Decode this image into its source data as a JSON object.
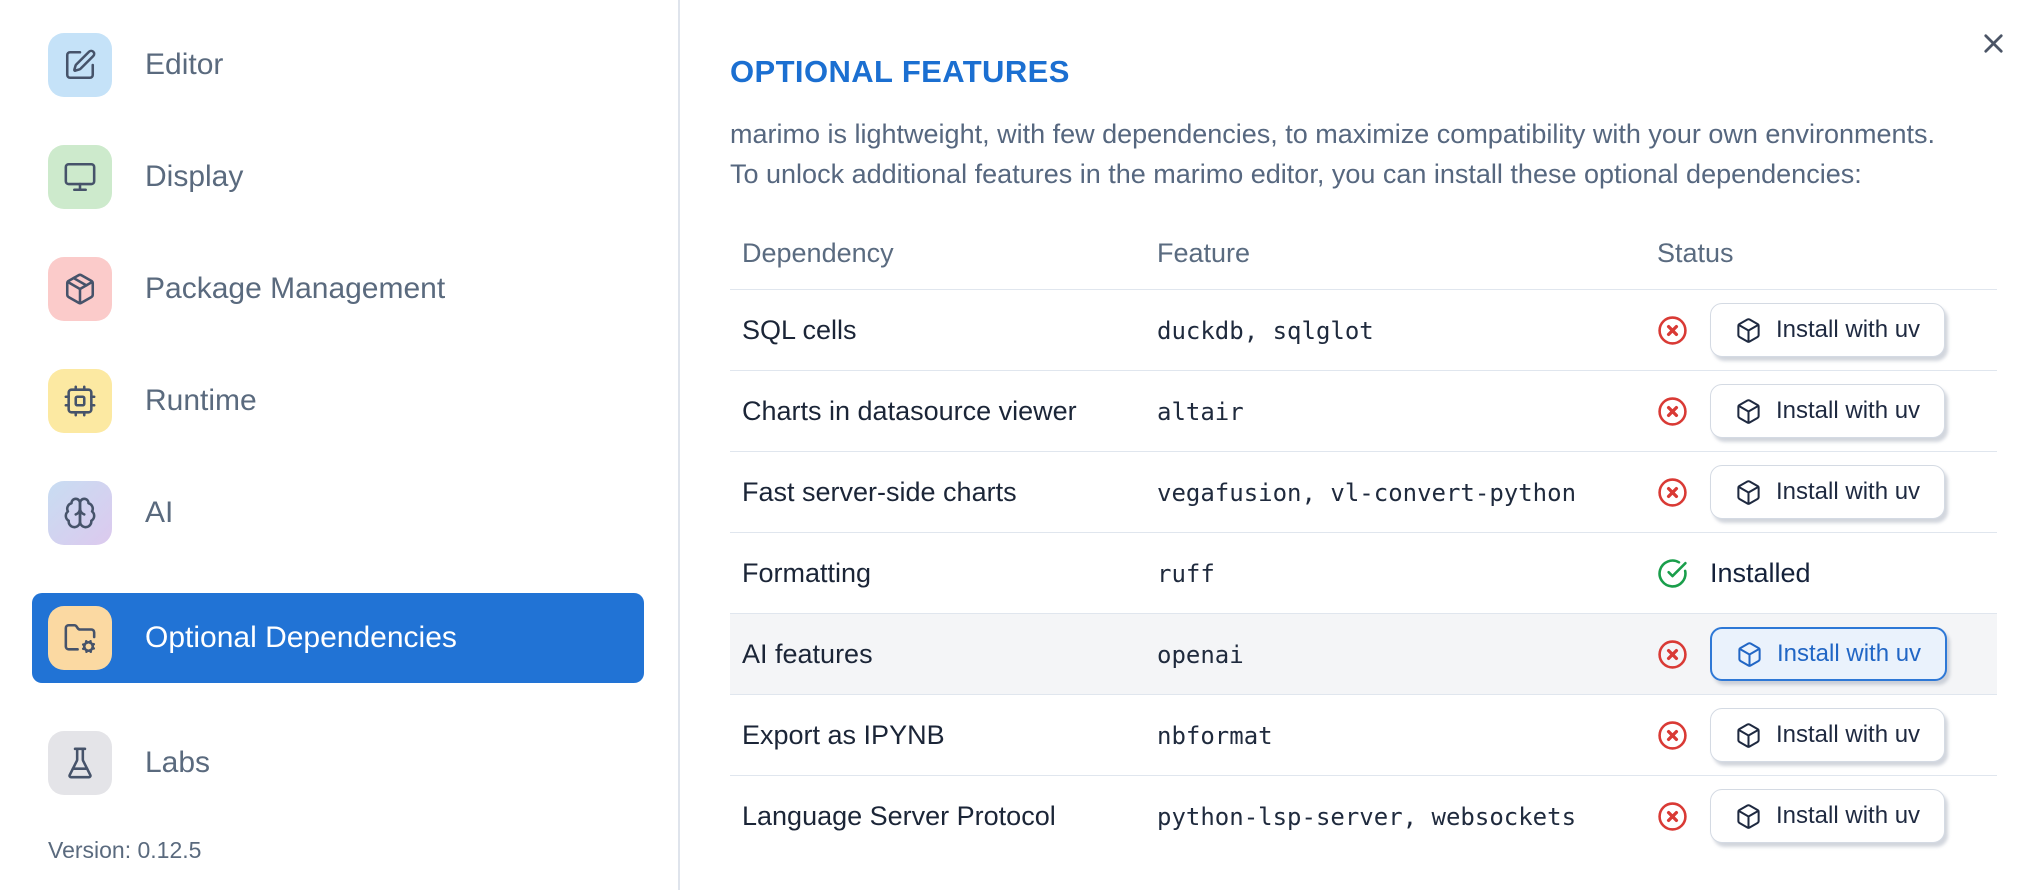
{
  "colors": {
    "sidebar_selected_blue": "#2173d5",
    "heading_blue": "#1b6fd1",
    "status_error_red": "#d93a35",
    "status_success_green": "#1a9e4b",
    "focused_button_blue": "#2e78d6",
    "focused_button_bg": "#eaf2fc",
    "row_highlight_gray": "#f4f5f7"
  },
  "sidebar": {
    "items": [
      {
        "label": "Editor",
        "icon": "edit-icon",
        "icon_bg": "#c5e2f8",
        "selected": false
      },
      {
        "label": "Display",
        "icon": "monitor-icon",
        "icon_bg": "#cdeacc",
        "selected": false
      },
      {
        "label": "Package Management",
        "icon": "package-icon",
        "icon_bg": "#fbcbca",
        "selected": false
      },
      {
        "label": "Runtime",
        "icon": "cpu-icon",
        "icon_bg": "#fce9a2",
        "selected": false
      },
      {
        "label": "AI",
        "icon": "brain-icon",
        "icon_bg": "linear-gradient(135deg,#c8ddf2,#dcc9ee)",
        "selected": false
      },
      {
        "label": "Optional Dependencies",
        "icon": "folder-cog-icon",
        "icon_bg": "#fbd9a2",
        "selected": true
      },
      {
        "label": "Labs",
        "icon": "flask-icon",
        "icon_bg": "#e4e4e8",
        "selected": false
      }
    ],
    "version_label": "Version: 0.12.5"
  },
  "panel": {
    "title": "OPTIONAL FEATURES",
    "description": [
      "marimo is lightweight, with few dependencies, to maximize compatibility with your own environments.",
      "To unlock additional features in the marimo editor, you can install these optional dependencies:"
    ]
  },
  "table": {
    "columns": [
      "Dependency",
      "Feature",
      "Status"
    ],
    "install_button_label": "Install with uv",
    "installed_label": "Installed",
    "rows": [
      {
        "dependency": "SQL cells",
        "feature": "duckdb, sqlglot",
        "installed": false,
        "highlighted": false
      },
      {
        "dependency": "Charts in datasource viewer",
        "feature": "altair",
        "installed": false,
        "highlighted": false
      },
      {
        "dependency": "Fast server-side charts",
        "feature": "vegafusion, vl-convert-python",
        "installed": false,
        "highlighted": false
      },
      {
        "dependency": "Formatting",
        "feature": "ruff",
        "installed": true,
        "highlighted": false
      },
      {
        "dependency": "AI features",
        "feature": "openai",
        "installed": false,
        "highlighted": true
      },
      {
        "dependency": "Export as IPYNB",
        "feature": "nbformat",
        "installed": false,
        "highlighted": false
      },
      {
        "dependency": "Language Server Protocol",
        "feature": "python-lsp-server, websockets",
        "installed": false,
        "highlighted": false
      }
    ]
  }
}
